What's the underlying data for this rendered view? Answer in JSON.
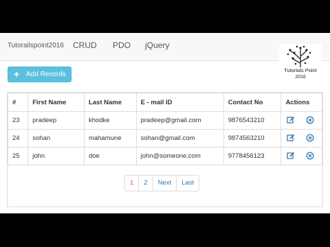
{
  "navbar": {
    "brand": "Tutorailspoint2016",
    "links": [
      "CRUD",
      "PDO",
      "jQuery"
    ]
  },
  "logo": {
    "name": "Tutorials Point",
    "year": "2016"
  },
  "add_button": {
    "icon": "plus-icon",
    "label": "Add Records"
  },
  "table": {
    "headers": [
      "#",
      "First Name",
      "Last Name",
      "E - mail ID",
      "Contact No",
      "Actions"
    ],
    "rows": [
      {
        "id": "23",
        "first": "pradeep",
        "last": "khodke",
        "email": "pradeep@gmail.com",
        "contact": "9876543210"
      },
      {
        "id": "24",
        "first": "sohan",
        "last": "mahamune",
        "email": "sohan@gmail.com",
        "contact": "9874563210"
      },
      {
        "id": "25",
        "first": "john",
        "last": "doe",
        "email": "john@someone.com",
        "contact": "9778456123"
      }
    ],
    "actions": {
      "edit_icon": "edit-icon",
      "delete_icon": "delete-icon"
    }
  },
  "pagination": [
    "1",
    "2",
    "Next",
    "Last"
  ],
  "colors": {
    "accent": "#5bc0de",
    "link": "#337ab7",
    "active_page": "#d9534f"
  }
}
